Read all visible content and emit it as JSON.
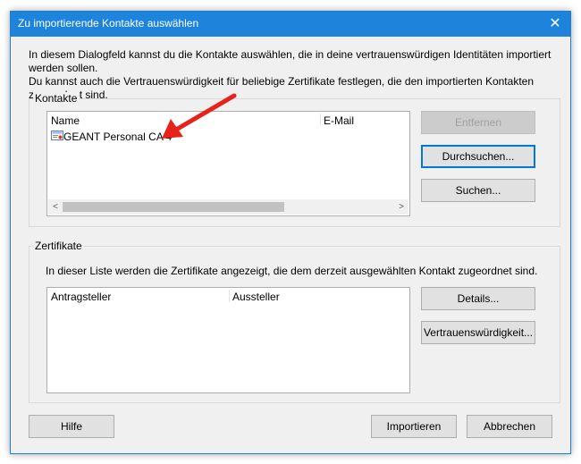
{
  "window": {
    "title": "Zu importierende Kontakte auswählen",
    "close_glyph": "✕"
  },
  "description": {
    "line1": "In diesem Dialogfeld kannst du die Kontakte auswählen, die in deine vertrauenswürdigen Identitäten importiert werden sollen.",
    "line2": "Du kannst auch die Vertrauenswürdigkeit für beliebige Zertifikate festlegen, die den importierten Kontakten zugeordnet sind."
  },
  "contacts": {
    "group_label": "Kontakte",
    "columns": [
      "Name",
      "E-Mail"
    ],
    "rows": [
      {
        "name": "GEANT Personal CA 4",
        "email": "",
        "icon": "certificate-icon"
      }
    ],
    "buttons": {
      "remove": "Entfernen",
      "browse": "Durchsuchen...",
      "search": "Suchen..."
    },
    "scroll_left": "<",
    "scroll_right": ">"
  },
  "certificates": {
    "group_label": "Zertifikate",
    "description": "In dieser Liste werden die Zertifikate angezeigt, die dem derzeit ausgewählten Kontakt zugeordnet sind.",
    "columns": [
      "Antragsteller",
      "Aussteller"
    ],
    "buttons": {
      "details": "Details...",
      "trust": "Vertrauenswürdigkeit..."
    }
  },
  "footer": {
    "help": "Hilfe",
    "import": "Importieren",
    "cancel": "Abbrechen"
  },
  "annotation": {
    "arrow_color": "#e8211b"
  },
  "colors": {
    "titlebar": "#1e83da",
    "focus": "#0078d7"
  }
}
